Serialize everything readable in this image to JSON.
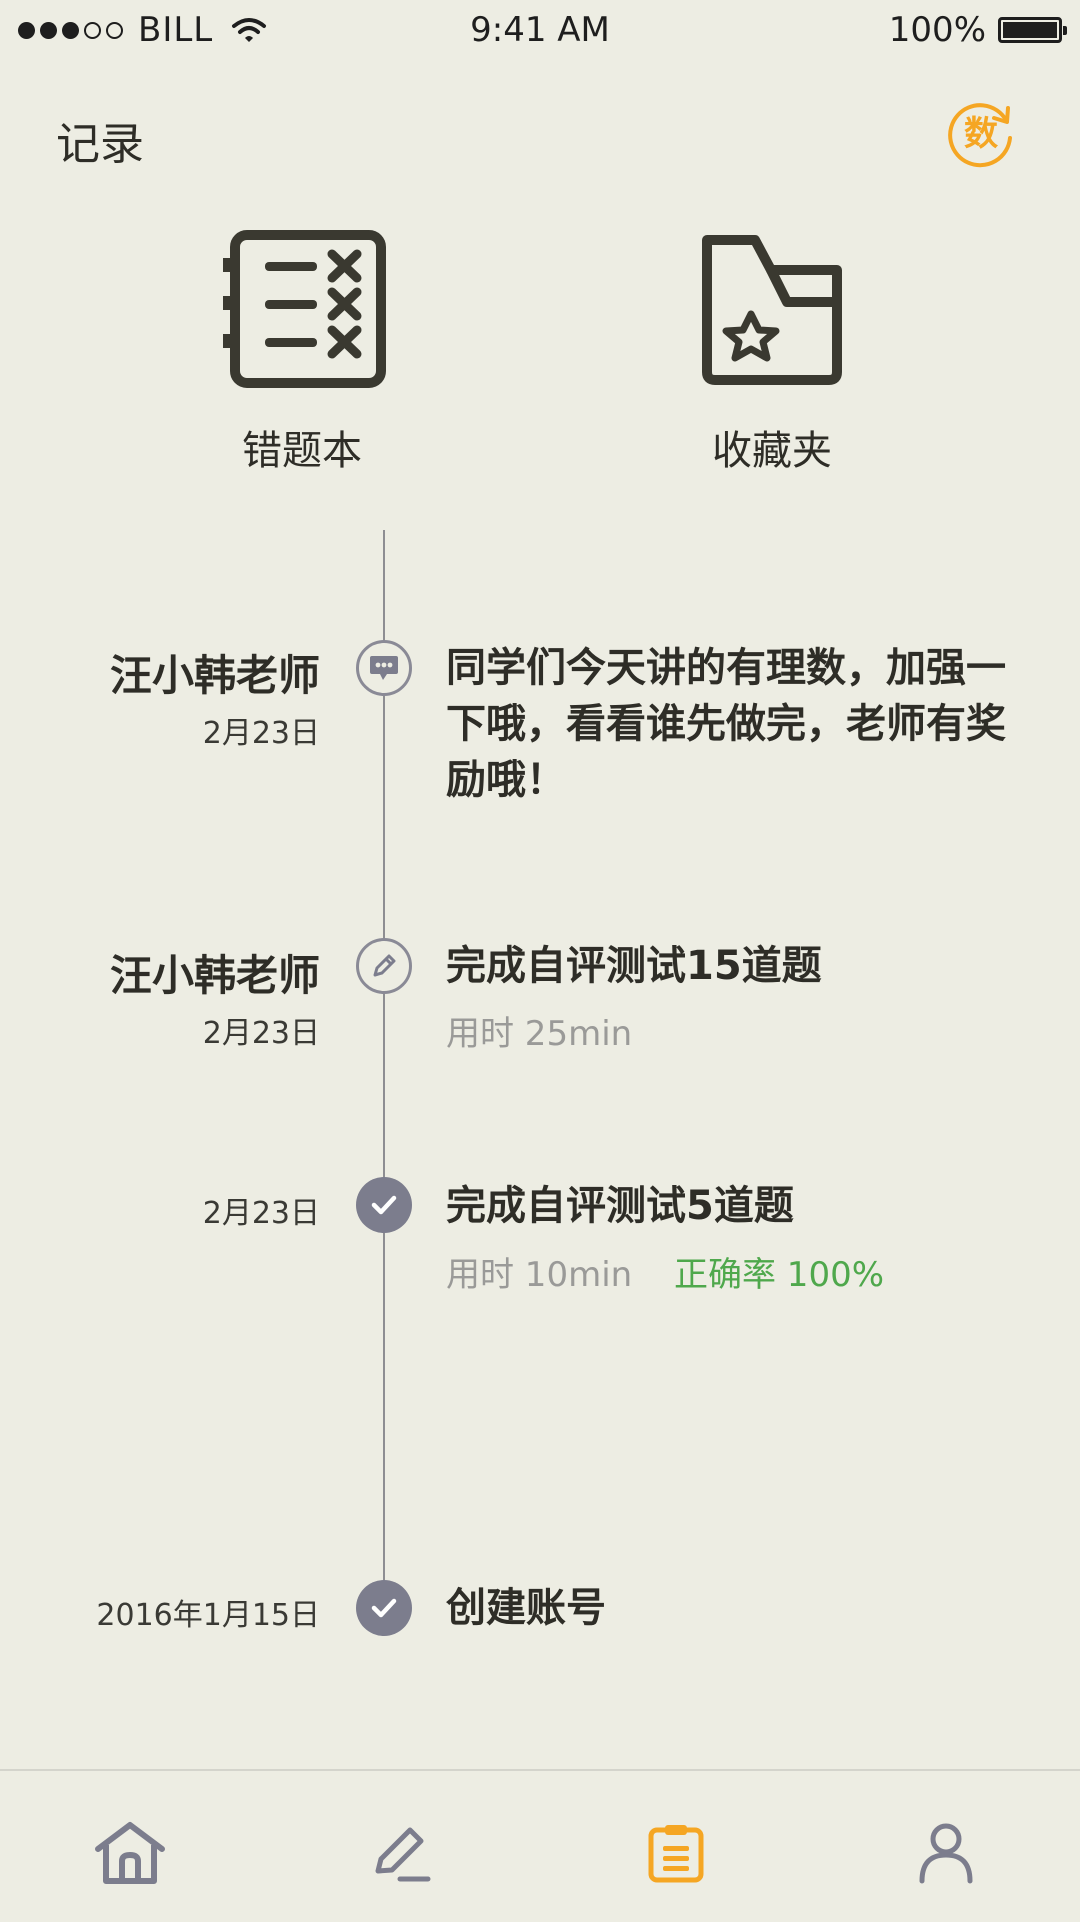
{
  "status_bar": {
    "carrier": "BILL",
    "time": "9:41 AM",
    "battery": "100%",
    "signal_bars_filled": 3,
    "signal_bars_total": 5
  },
  "header": {
    "title": "记录",
    "subject_badge": "数"
  },
  "shortcuts": [
    {
      "label": "错题本",
      "icon": "mistake-notebook-icon"
    },
    {
      "label": "收藏夹",
      "icon": "favorites-folder-icon"
    }
  ],
  "timeline": [
    {
      "author": "汪小韩老师",
      "date": "2月23日",
      "icon": "message-icon",
      "text": "同学们今天讲的有理数，加强一下哦，看看谁先做完，老师有奖励哦！"
    },
    {
      "author": "汪小韩老师",
      "date": "2月23日",
      "icon": "pencil-icon",
      "text": "完成自评测试15道题",
      "duration": "用时 25min"
    },
    {
      "date": "2月23日",
      "icon": "check-icon",
      "text": "完成自评测试5道题",
      "duration": "用时 10min",
      "accuracy": "正确率 100%"
    },
    {
      "date": "2016年1月15日",
      "icon": "check-icon",
      "text": "创建账号"
    }
  ],
  "tabbar": [
    {
      "icon": "home-icon",
      "active": false
    },
    {
      "icon": "edit-icon",
      "active": false
    },
    {
      "icon": "clipboard-icon",
      "active": true
    },
    {
      "icon": "profile-icon",
      "active": false
    }
  ],
  "colors": {
    "background": "#EDEDE3",
    "accent": "#F5A623",
    "success": "#4FA84C",
    "node": "#7C7D8D",
    "muted": "#9A9A98"
  }
}
